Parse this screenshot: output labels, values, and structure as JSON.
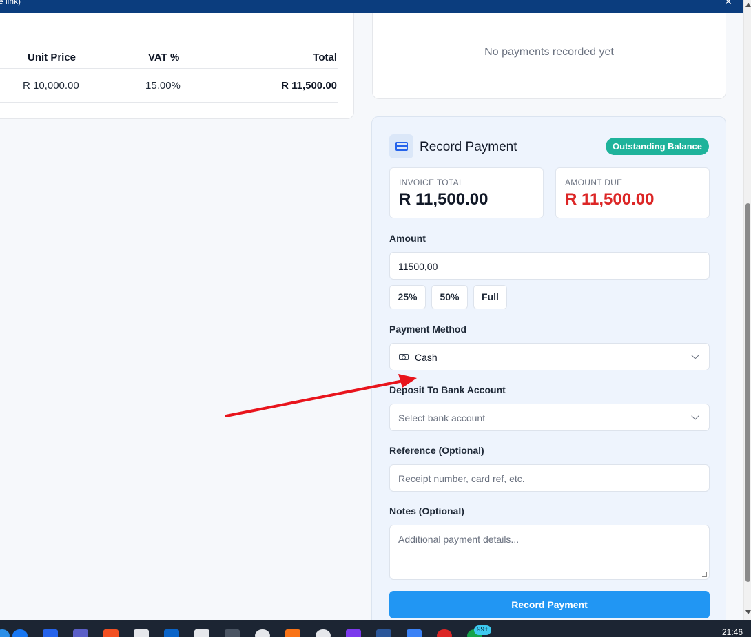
{
  "window": {
    "title": "e link)",
    "close_glyph": "✕"
  },
  "items_table": {
    "headers": {
      "unit_price": "Unit Price",
      "vat": "VAT %",
      "total": "Total"
    },
    "rows": [
      {
        "unit_price": "R 10,000.00",
        "vat": "15.00%",
        "total": "R 11,500.00"
      }
    ]
  },
  "payments": {
    "empty_message": "No payments recorded yet"
  },
  "record_payment": {
    "title": "Record Payment",
    "status_badge": "Outstanding Balance",
    "invoice_total_label": "INVOICE TOTAL",
    "invoice_total_value": "R 11,500.00",
    "amount_due_label": "AMOUNT DUE",
    "amount_due_value": "R 11,500.00",
    "amount_label": "Amount",
    "amount_value": "11500,00",
    "quick_buttons": [
      "25%",
      "50%",
      "Full"
    ],
    "method_label": "Payment Method",
    "method_value": "Cash",
    "bank_label": "Deposit To Bank Account",
    "bank_placeholder": "Select bank account",
    "reference_label": "Reference (Optional)",
    "reference_placeholder": "Receipt number, card ref, etc.",
    "notes_label": "Notes (Optional)",
    "notes_placeholder": "Additional payment details...",
    "submit_label": "Record Payment"
  },
  "taskbar": {
    "time": "21:46",
    "notification_badge": "99+"
  },
  "colors": {
    "accent": "#2196f3",
    "badge": "#1fb39b",
    "due": "#dc2626",
    "annotation_arrow": "#e8141c"
  },
  "icons": [
    "credit-card-icon",
    "cash-icon",
    "chevron-down-icon"
  ]
}
